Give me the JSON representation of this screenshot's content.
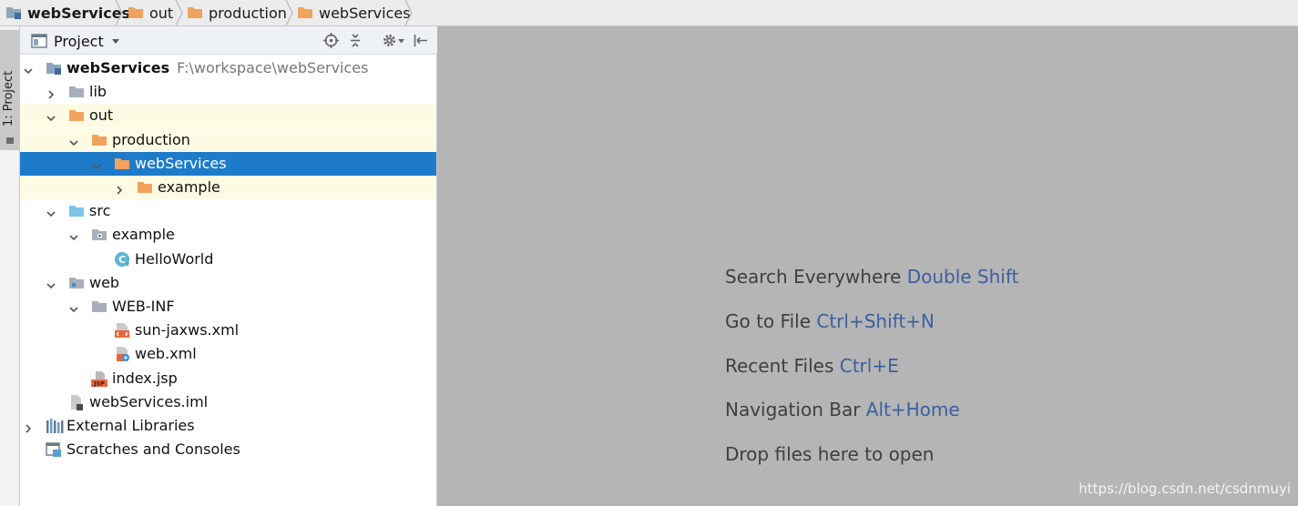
{
  "breadcrumb": [
    {
      "label": "webServices",
      "icon": "module-icon",
      "bold": true
    },
    {
      "label": "out",
      "icon": "folder-orange-icon"
    },
    {
      "label": "production",
      "icon": "folder-orange-icon"
    },
    {
      "label": "webServices",
      "icon": "folder-orange-icon"
    }
  ],
  "stripe": {
    "tab_label": "1: Project"
  },
  "panel": {
    "title": "Project",
    "dropdown_icon": "chevron-down-icon"
  },
  "tree": [
    {
      "label": "webServices",
      "hint": "F:\\workspace\\webServices",
      "level": 0,
      "expanded": true,
      "icon": "module-icon",
      "bold": true
    },
    {
      "label": "lib",
      "level": 1,
      "expanded": false,
      "icon": "folder-gray-icon"
    },
    {
      "label": "out",
      "level": 1,
      "expanded": true,
      "icon": "folder-orange-icon",
      "highlight": true
    },
    {
      "label": "production",
      "level": 2,
      "expanded": true,
      "icon": "folder-orange-icon",
      "highlight": true
    },
    {
      "label": "webServices",
      "level": 3,
      "expanded": true,
      "icon": "folder-orange-icon",
      "selected": true
    },
    {
      "label": "example",
      "level": 4,
      "expanded": false,
      "icon": "folder-orange-icon",
      "highlight": true
    },
    {
      "label": "src",
      "level": 1,
      "expanded": true,
      "icon": "folder-blue-icon"
    },
    {
      "label": "example",
      "level": 2,
      "expanded": true,
      "icon": "package-icon"
    },
    {
      "label": "HelloWorld",
      "level": 3,
      "icon": "java-class-icon"
    },
    {
      "label": "web",
      "level": 1,
      "expanded": true,
      "icon": "folder-web-icon"
    },
    {
      "label": "WEB-INF",
      "level": 2,
      "expanded": true,
      "icon": "folder-gray-icon"
    },
    {
      "label": "sun-jaxws.xml",
      "level": 3,
      "icon": "xml-file-icon"
    },
    {
      "label": "web.xml",
      "level": 3,
      "icon": "web-xml-icon"
    },
    {
      "label": "index.jsp",
      "level": 2,
      "icon": "jsp-file-icon"
    },
    {
      "label": "webServices.iml",
      "level": 1,
      "icon": "iml-file-icon"
    },
    {
      "label": "External Libraries",
      "level": 0,
      "expanded": false,
      "icon": "libraries-icon"
    },
    {
      "label": "Scratches and Consoles",
      "level": 0,
      "icon": "scratches-icon"
    }
  ],
  "editor": {
    "tips": [
      {
        "text": "Search Everywhere",
        "key": "Double Shift"
      },
      {
        "text": "Go to File",
        "key": "Ctrl+Shift+N"
      },
      {
        "text": "Recent Files",
        "key": "Ctrl+E"
      },
      {
        "text": "Navigation Bar",
        "key": "Alt+Home"
      },
      {
        "text": "Drop files here to open",
        "key": ""
      }
    ],
    "watermark": "https://blog.csdn.net/csdnmuyi"
  },
  "colors": {
    "selection": "#1e7bc9",
    "highlight_row": "#fdfbe3",
    "editor_bg": "#b5b5b5",
    "shortcut": "#3b5fa0",
    "folder_orange": "#f0a35c"
  }
}
